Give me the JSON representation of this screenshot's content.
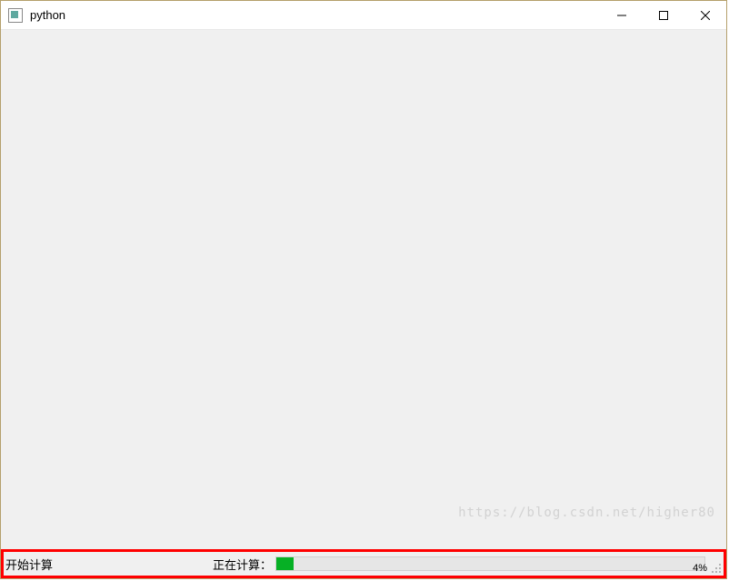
{
  "titlebar": {
    "title": "python"
  },
  "statusbar": {
    "left_text": "开始计算",
    "progress_label": "正在计算：",
    "progress_percent": 4,
    "progress_percent_text": "4%"
  },
  "watermark": "https://blog.csdn.net/higher80",
  "colors": {
    "progress_fill": "#06b025",
    "highlight_border": "#ff0000"
  }
}
